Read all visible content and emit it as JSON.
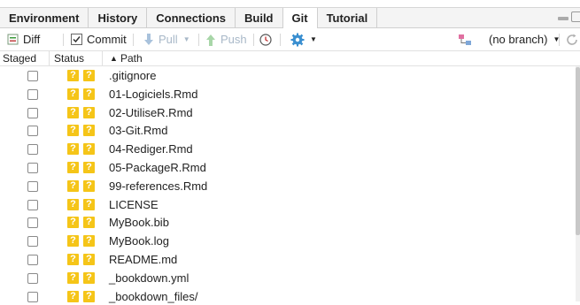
{
  "tabs": [
    {
      "label": "Environment",
      "active": false
    },
    {
      "label": "History",
      "active": false
    },
    {
      "label": "Connections",
      "active": false
    },
    {
      "label": "Build",
      "active": false
    },
    {
      "label": "Git",
      "active": true
    },
    {
      "label": "Tutorial",
      "active": false
    }
  ],
  "toolbar": {
    "diff_label": "Diff",
    "commit_label": "Commit",
    "pull_label": "Pull",
    "push_label": "Push",
    "branch_label": "(no branch)"
  },
  "table": {
    "headers": {
      "staged": "Staged",
      "status": "Status",
      "path": "Path"
    },
    "sort_indicator": "▲",
    "status_glyph": "?",
    "rows": [
      {
        "path": ".gitignore"
      },
      {
        "path": "01-Logiciels.Rmd"
      },
      {
        "path": "02-UtiliseR.Rmd"
      },
      {
        "path": "03-Git.Rmd"
      },
      {
        "path": "04-Rediger.Rmd"
      },
      {
        "path": "05-PackageR.Rmd"
      },
      {
        "path": "99-references.Rmd"
      },
      {
        "path": "LICENSE"
      },
      {
        "path": "MyBook.bib"
      },
      {
        "path": "MyBook.log"
      },
      {
        "path": "README.md"
      },
      {
        "path": "_bookdown.yml"
      },
      {
        "path": "_bookdown_files/"
      }
    ]
  },
  "colors": {
    "untracked_badge": "#f5c518",
    "tab_bar": "#f4f4f4",
    "disabled_text": "#a8b8c8"
  }
}
